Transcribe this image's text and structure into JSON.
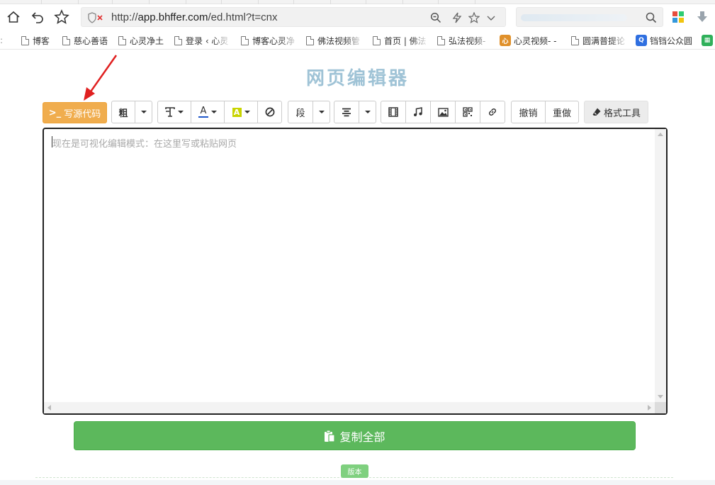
{
  "browser": {
    "url_prefix": "http://",
    "url_host": "app.bhffer.com",
    "url_path": "/ed.html?t=cnx",
    "bookmarks": [
      {
        "label": "博客",
        "icon": "doc-icon"
      },
      {
        "label": "慈心善语",
        "icon": "doc-icon"
      },
      {
        "label": "心灵净土",
        "icon": "doc-icon"
      },
      {
        "label": "登录 ‹ 心灵",
        "icon": "doc-icon"
      },
      {
        "label": "博客心灵净",
        "icon": "doc-icon"
      },
      {
        "label": "佛法视频管",
        "icon": "doc-icon"
      },
      {
        "label": "首页 | 佛法",
        "icon": "doc-icon"
      },
      {
        "label": "弘法视频-",
        "icon": "doc-icon"
      },
      {
        "label": "心灵视频- -",
        "icon": "site-icon"
      },
      {
        "label": "圆满普提论",
        "icon": "doc-icon"
      },
      {
        "label": "铛铛公众圆",
        "icon": "q-icon"
      }
    ],
    "colors": {
      "q_icon": "#2f6fe0",
      "site_icon": "#e0902a",
      "green_icon": "#2fb05a"
    }
  },
  "page": {
    "title": "网页编辑器",
    "source_button": "写源代码",
    "toolbar": {
      "bold": "粗",
      "paragraph": "段",
      "undo": "撤销",
      "redo": "重做",
      "format_tool": "格式工具",
      "color_letter": "A"
    },
    "editor_placeholder": "现在是可视化编辑模式：在这里写或粘贴网页",
    "copy_all": "复制全部",
    "version": "版本"
  },
  "colors": {
    "source_button": "#f0ad4e",
    "copy_button": "#5cb85c",
    "title": "#9fc3d6",
    "highlight": "#c8d400",
    "font_color": "#1f57c9"
  }
}
